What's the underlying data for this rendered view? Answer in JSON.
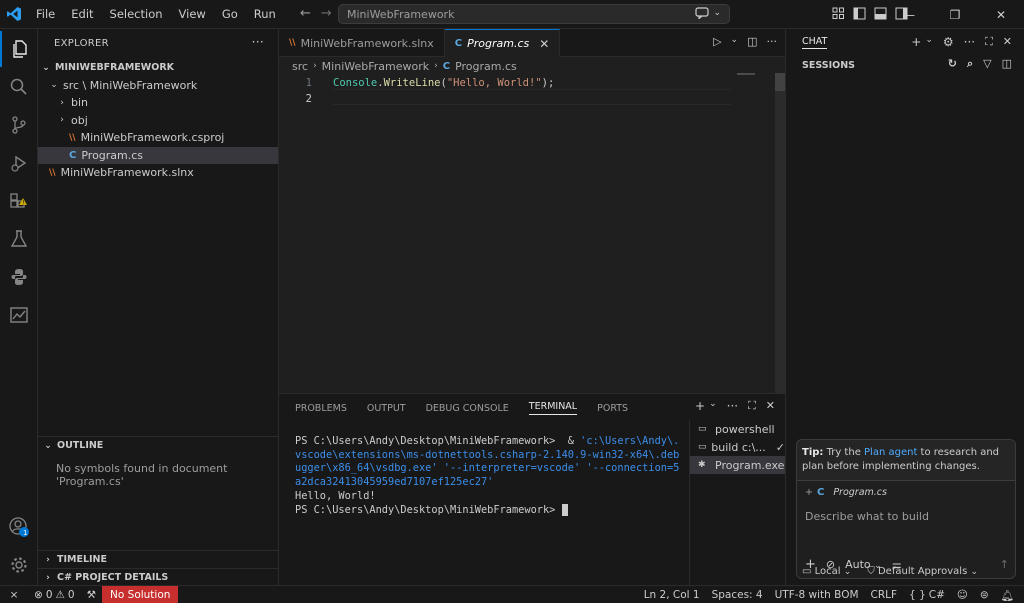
{
  "titlebar": {
    "menu": [
      "File",
      "Edit",
      "Selection",
      "View",
      "Go",
      "Run"
    ],
    "search_text": "MiniWebFramework"
  },
  "explorer": {
    "header": "EXPLORER",
    "root": "MINIWEBFRAMEWORK",
    "items": [
      {
        "label": "src \\ MiniWebFramework"
      },
      {
        "label": "bin"
      },
      {
        "label": "obj"
      },
      {
        "label": "MiniWebFramework.csproj"
      },
      {
        "label": "Program.cs"
      },
      {
        "label": "MiniWebFramework.slnx"
      }
    ],
    "outline_header": "OUTLINE",
    "outline_message": "No symbols found in document 'Program.cs'",
    "timeline_header": "TIMELINE",
    "csharp_header": "C# PROJECT DETAILS",
    "account_badge": "1"
  },
  "editor": {
    "tabs": [
      {
        "label": "MiniWebFramework.slnx"
      },
      {
        "label": "Program.cs"
      }
    ],
    "breadcrumb": [
      "src",
      "MiniWebFramework",
      "Program.cs"
    ],
    "lines": [
      {
        "number": "1",
        "cls": "Console",
        "dot": ".",
        "fn": "WriteLine",
        "open": "(",
        "str": "\"Hello, World!\"",
        "close": ");"
      },
      {
        "number": "2"
      }
    ]
  },
  "panel": {
    "tabs": [
      "PROBLEMS",
      "OUTPUT",
      "DEBUG CONSOLE",
      "TERMINAL",
      "PORTS"
    ],
    "terminal": {
      "prompt1": "PS C:\\Users\\Andy\\Desktop\\MiniWebFramework>  & ",
      "cmd_path": "'c:\\Users\\Andy\\.vscode\\extensions\\ms-dotnettools.csharp-2.140.9-win32-x64\\.debugger\\x86_64\\vsdbg.exe'",
      "cmd_args": " '--interpreter=vscode' '--connection=5a2dca32413045959ed7107ef125ec27'",
      "output": "Hello, World!",
      "prompt2": "PS C:\\Users\\Andy\\Desktop\\MiniWebFramework> "
    },
    "terminals": [
      {
        "label": "powershell"
      },
      {
        "label": "build c:\\..."
      },
      {
        "label": "Program.exe"
      }
    ]
  },
  "chat": {
    "header": "CHAT",
    "sessions": "SESSIONS",
    "tip_bold": "Tip:",
    "tip_pre": " Try the ",
    "tip_link": "Plan agent",
    "tip_post": " to research and plan before implementing changes.",
    "context_file": "Program.cs",
    "input_placeholder": "Describe what to build",
    "mode": "Auto",
    "footer_local": "Local",
    "footer_approvals": "Default Approvals"
  },
  "status": {
    "errors": "0",
    "warnings": "0",
    "solution": "No Solution",
    "position": "Ln 2, Col 1",
    "spaces": "Spaces: 4",
    "encoding": "UTF-8 with BOM",
    "eol": "CRLF",
    "language": "C#"
  },
  "colors": {
    "accent": "#0078d4",
    "no_solution_bg": "#c72e2e",
    "link": "#4daafc"
  }
}
